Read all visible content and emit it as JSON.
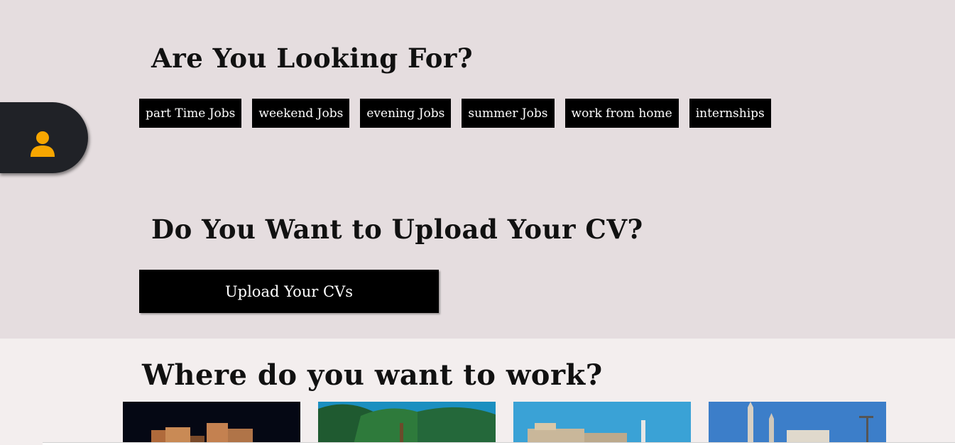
{
  "sections": {
    "looking_for": {
      "title": "Are You Looking For?",
      "chips": [
        {
          "label": "part Time Jobs"
        },
        {
          "label": "weekend Jobs"
        },
        {
          "label": "evening Jobs"
        },
        {
          "label": "summer Jobs"
        },
        {
          "label": "work from home"
        },
        {
          "label": "internships"
        }
      ]
    },
    "upload": {
      "title": "Do You Want to Upload Your CV?",
      "button_label": "Upload Your CVs"
    },
    "where": {
      "title": "Where do you want to work?",
      "cities": [
        {
          "icon": "city-skyline-night-image"
        },
        {
          "icon": "palm-trees-image"
        },
        {
          "icon": "fortress-coast-image"
        },
        {
          "icon": "mosque-minarets-image"
        }
      ]
    }
  },
  "side_tab": {
    "icon": "user-icon"
  },
  "colors": {
    "top_background": "#e5dddf",
    "page_background": "#f3eeee",
    "chip_background": "#000000",
    "side_tab_background": "#202227",
    "user_icon": "#f7a600"
  }
}
